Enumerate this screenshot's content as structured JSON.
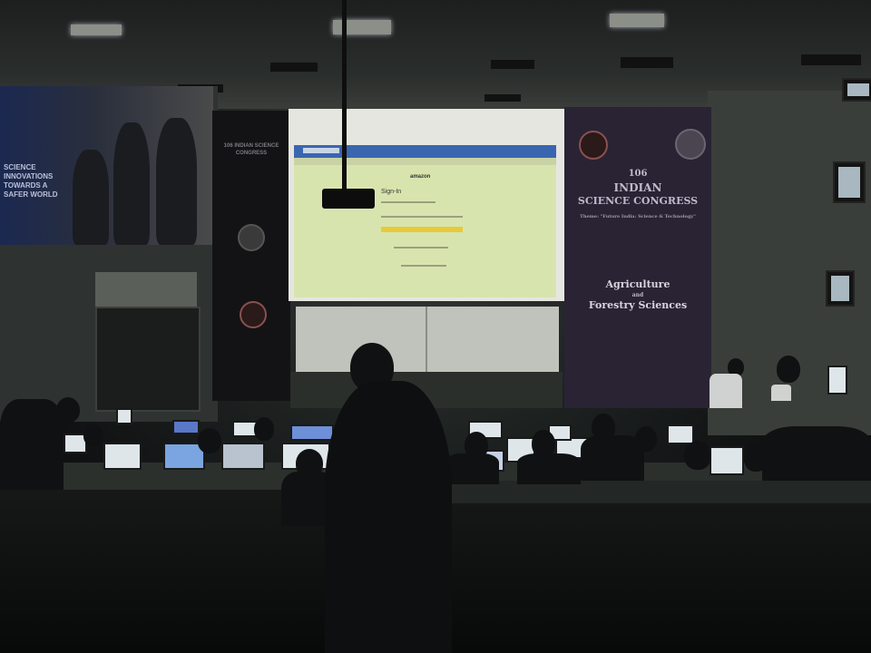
{
  "scene": {
    "banner_left_text": "SCIENCE INNOVATIONS TOWARDS A SAFER WORLD",
    "banner_dark_text": "106 INDIAN SCIENCE CONGRESS",
    "projection": {
      "site_logo": "amazon",
      "heading": "Sign-In"
    },
    "banner_right": {
      "edition": "106",
      "line1": "INDIAN",
      "line2": "SCIENCE CONGRESS",
      "theme": "Theme: \"Future India: Science & Technology\"",
      "session_line1": "Agriculture",
      "session_and": "and",
      "session_line2": "Forestry Sciences"
    }
  }
}
